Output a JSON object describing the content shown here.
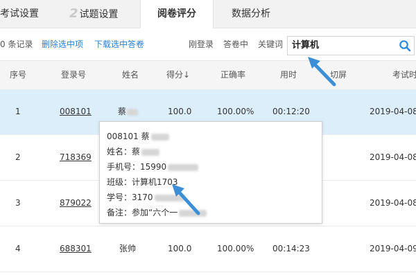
{
  "tabs": [
    {
      "label": "考试设置"
    },
    {
      "num": "2",
      "label": "试题设置"
    },
    {
      "label": "阅卷评分"
    },
    {
      "label": "数据分析"
    }
  ],
  "toolbar": {
    "count": "0 条记录",
    "delete_label": "删除选中项",
    "download_label": "下载选中答卷",
    "filter_login": "刚登录",
    "filter_answering": "答卷中",
    "keyword_label": "关键词",
    "search_value": "计算机"
  },
  "table": {
    "columns": [
      "序号",
      "登录号",
      "姓名",
      "得分↓",
      "正确率",
      "用时",
      "切屏",
      "考试时"
    ],
    "rows": [
      {
        "index": "1",
        "login": "008101",
        "name": "蔡",
        "score": "100.0",
        "accuracy": "100.00%",
        "time": "00:12:20",
        "switch": "",
        "date": "2019-04-08"
      },
      {
        "index": "2",
        "login": "718369",
        "name": "",
        "score": "",
        "accuracy": "",
        "time": "",
        "switch": "",
        "date": "2019-04-08"
      },
      {
        "index": "3",
        "login": "879022",
        "name": "",
        "score": "",
        "accuracy": "",
        "time": "",
        "switch": "",
        "date": "2019-04-08"
      },
      {
        "index": "4",
        "login": "688301",
        "name": "张帅",
        "score": "100.0",
        "accuracy": "100.00%",
        "time": "00:14:23",
        "switch": "",
        "date": "2019-04-09"
      }
    ]
  },
  "tooltip": {
    "line1": "008101 蔡",
    "line2": "姓名：蔡",
    "line3": "手机号：15990",
    "line4": "班级：计算机1703",
    "line5": "学号：3170",
    "line6": "备注：参加“六个一"
  },
  "colors": {
    "link": "#2a7fd4",
    "arrow": "#3c8fd6",
    "selected_row": "#ddeefb",
    "search_icon": "#2a8ae0"
  },
  "icons": {
    "search": "search-icon"
  }
}
